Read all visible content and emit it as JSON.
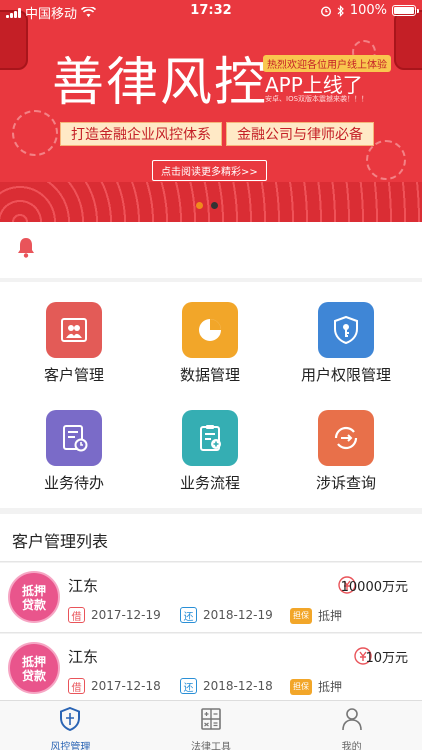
{
  "status_bar": {
    "carrier": "中国移动",
    "time": "17:32",
    "battery": "100%"
  },
  "banner": {
    "title": "善律风控",
    "welcome": "热烈欢迎各位用户线上体验",
    "launch": "APP上线了",
    "subtitle": "安卓、IOS双版本震撼来袭！！！",
    "pill_left": "打造金融企业风控体系",
    "pill_right": "金融公司与律师必备",
    "read_more": "点击阅读更多精彩>>",
    "active_slide": 1,
    "slide_count": 2
  },
  "grid": [
    {
      "label": "客户管理",
      "icon": "customer-icon",
      "color": "#e35b57"
    },
    {
      "label": "数据管理",
      "icon": "pie-chart-icon",
      "color": "#f2a629"
    },
    {
      "label": "用户权限管理",
      "icon": "shield-key-icon",
      "color": "#3f86d6"
    },
    {
      "label": "业务待办",
      "icon": "todo-icon",
      "color": "#7a6bc8"
    },
    {
      "label": "业务流程",
      "icon": "clipboard-icon",
      "color": "#35aeb3"
    },
    {
      "label": "涉诉查询",
      "icon": "transfer-icon",
      "color": "#e8704a"
    }
  ],
  "list": {
    "title": "客户管理列表",
    "badge_text": "抵押贷款",
    "items": [
      {
        "name": "江东",
        "amount": "10000万元",
        "borrow_tag": "借",
        "borrow_date": "2017-12-19",
        "return_tag": "还",
        "return_date": "2018-12-19",
        "type_tag": "担保",
        "type": "抵押"
      },
      {
        "name": "江东",
        "amount": "10万元",
        "borrow_tag": "借",
        "borrow_date": "2017-12-18",
        "return_tag": "还",
        "return_date": "2018-12-18",
        "type_tag": "担保",
        "type": "抵押"
      }
    ]
  },
  "tabbar": [
    {
      "label": "风控管理",
      "icon": "shield-icon",
      "active": true
    },
    {
      "label": "法律工具",
      "icon": "calculator-icon",
      "active": false
    },
    {
      "label": "我的",
      "icon": "person-icon",
      "active": false
    }
  ],
  "colors": {
    "brand_red": "#e9383f",
    "tab_active": "#2a64b4"
  }
}
